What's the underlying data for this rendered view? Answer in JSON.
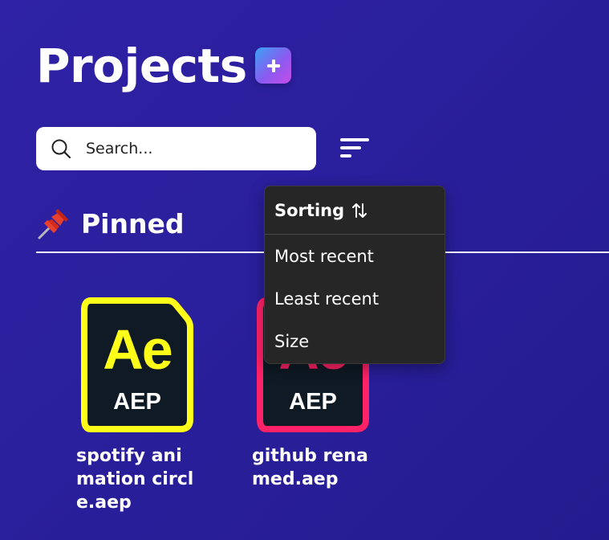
{
  "header": {
    "title": "Projects",
    "add_icon": "plus-icon"
  },
  "search": {
    "placeholder": "Search...",
    "value": "",
    "icon": "search-icon"
  },
  "sort_toggle": {
    "icon": "sort-lines-icon"
  },
  "section": {
    "icon": "pushpin-icon",
    "title": "Pinned"
  },
  "projects": [
    {
      "letters": "Ae",
      "extension": "AEP",
      "name": "spotify animation circle.aep",
      "accent_color": "#ffff1a"
    },
    {
      "letters": "Ae",
      "extension": "AEP",
      "name": "github renamed.aep",
      "accent_color": "#ff2266"
    }
  ],
  "sort_menu": {
    "title": "Sorting",
    "title_icon": "sort-arrows-icon",
    "options": [
      "Most recent",
      "Least recent",
      "Size"
    ]
  },
  "colors": {
    "background": "#2a1f9c",
    "menu_background": "#262626",
    "file_icon_background": "#0f1a24"
  }
}
